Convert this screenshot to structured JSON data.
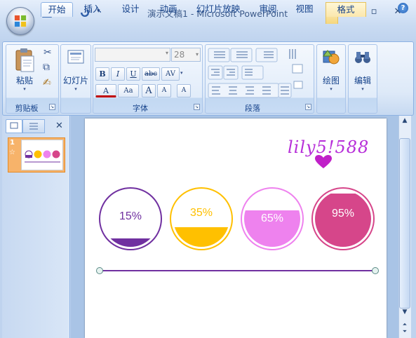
{
  "window": {
    "title": "演示文稿1 - Microsoft PowerPoint",
    "minimize_glyph": "—",
    "maximize_glyph": "▫",
    "close_glyph": "✕",
    "help_glyph": "?"
  },
  "quick_access": {
    "icons": [
      "save-icon",
      "undo-icon",
      "redo-icon",
      "customize-dropdown-icon"
    ],
    "customize_glyph": "▾"
  },
  "tabs": [
    {
      "label": "开始",
      "active": true
    },
    {
      "label": "插入"
    },
    {
      "label": "设计"
    },
    {
      "label": "动画"
    },
    {
      "label": "幻灯片放映"
    },
    {
      "label": "审阅"
    },
    {
      "label": "视图"
    },
    {
      "label": "格式",
      "contextual": true
    }
  ],
  "ribbon": {
    "clipboard": {
      "group_label": "剪贴板",
      "paste_label": "粘贴",
      "cut_glyph": "✂",
      "copy_glyph": "⧉",
      "painter_glyph": "✍"
    },
    "slides": {
      "new_slide_label": "幻灯片"
    },
    "font": {
      "group_label": "字体",
      "font_name": "",
      "font_size": "28",
      "bold": "B",
      "italic": "I",
      "underline": "U",
      "strikethrough": "abc",
      "char_spacing": "AV",
      "font_color": "A",
      "change_case": "Aa",
      "grow_font": "A",
      "shrink_font": "A",
      "clear_format": "A"
    },
    "paragraph": {
      "group_label": "段落"
    },
    "drawing": {
      "label": "绘图"
    },
    "editing": {
      "label": "编辑"
    }
  },
  "left_pane": {
    "slide_number": "1",
    "slide_star": "☆",
    "close_glyph": "✕"
  },
  "slide": {
    "signature": "lily5!588",
    "circles": [
      {
        "label": "15%",
        "fill_fraction": 0.15,
        "color": "#7030a0",
        "label_color": "#7030a0"
      },
      {
        "label": "35%",
        "fill_fraction": 0.35,
        "color": "#ffc000",
        "label_color": "#ffc000"
      },
      {
        "label": "65%",
        "fill_fraction": 0.65,
        "color": "#ee82ee",
        "label_color": "#ffffff"
      },
      {
        "label": "95%",
        "fill_fraction": 0.95,
        "color": "#d6468a",
        "label_color": "#ffffff"
      }
    ],
    "line_color": "#7030a0"
  },
  "colors": {
    "ribbon_text": "#15428b",
    "signature": "#b72fd9",
    "heart": "#c020c8"
  }
}
